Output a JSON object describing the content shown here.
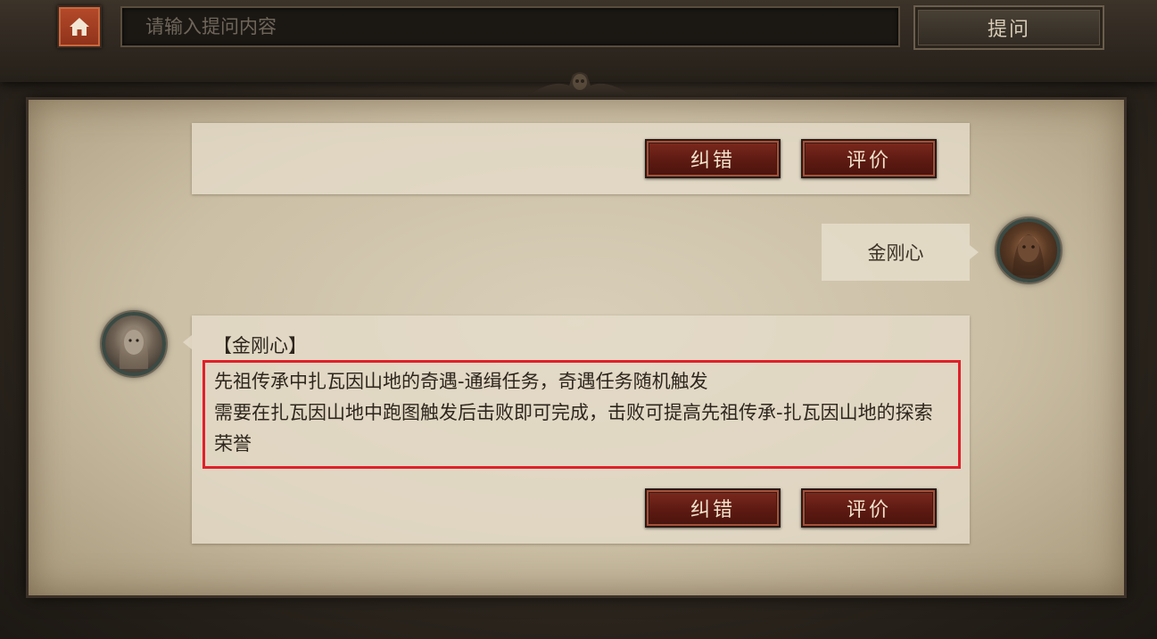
{
  "header": {
    "home_icon": "home-icon",
    "search_placeholder": "请输入提问内容",
    "ask_label": "提问"
  },
  "colors": {
    "accent_red": "#e0202a",
    "button_red": "#6d2016",
    "parchment": "#d9cfb9"
  },
  "previous_answer": {
    "correct_label": "纠错",
    "rate_label": "评价"
  },
  "user_message": {
    "text": "金刚心",
    "avatar_icon": "user-avatar"
  },
  "answer": {
    "title": "【金刚心】",
    "lines": [
      " 先祖传承中扎瓦因山地的奇遇-通缉任务，奇遇任务随机触发",
      " 需要在扎瓦因山地中跑图触发后击败即可完成，击败可提高先祖传承-扎瓦因山地的探索荣誉"
    ],
    "correct_label": "纠错",
    "rate_label": "评价",
    "avatar_icon": "assistant-avatar"
  }
}
